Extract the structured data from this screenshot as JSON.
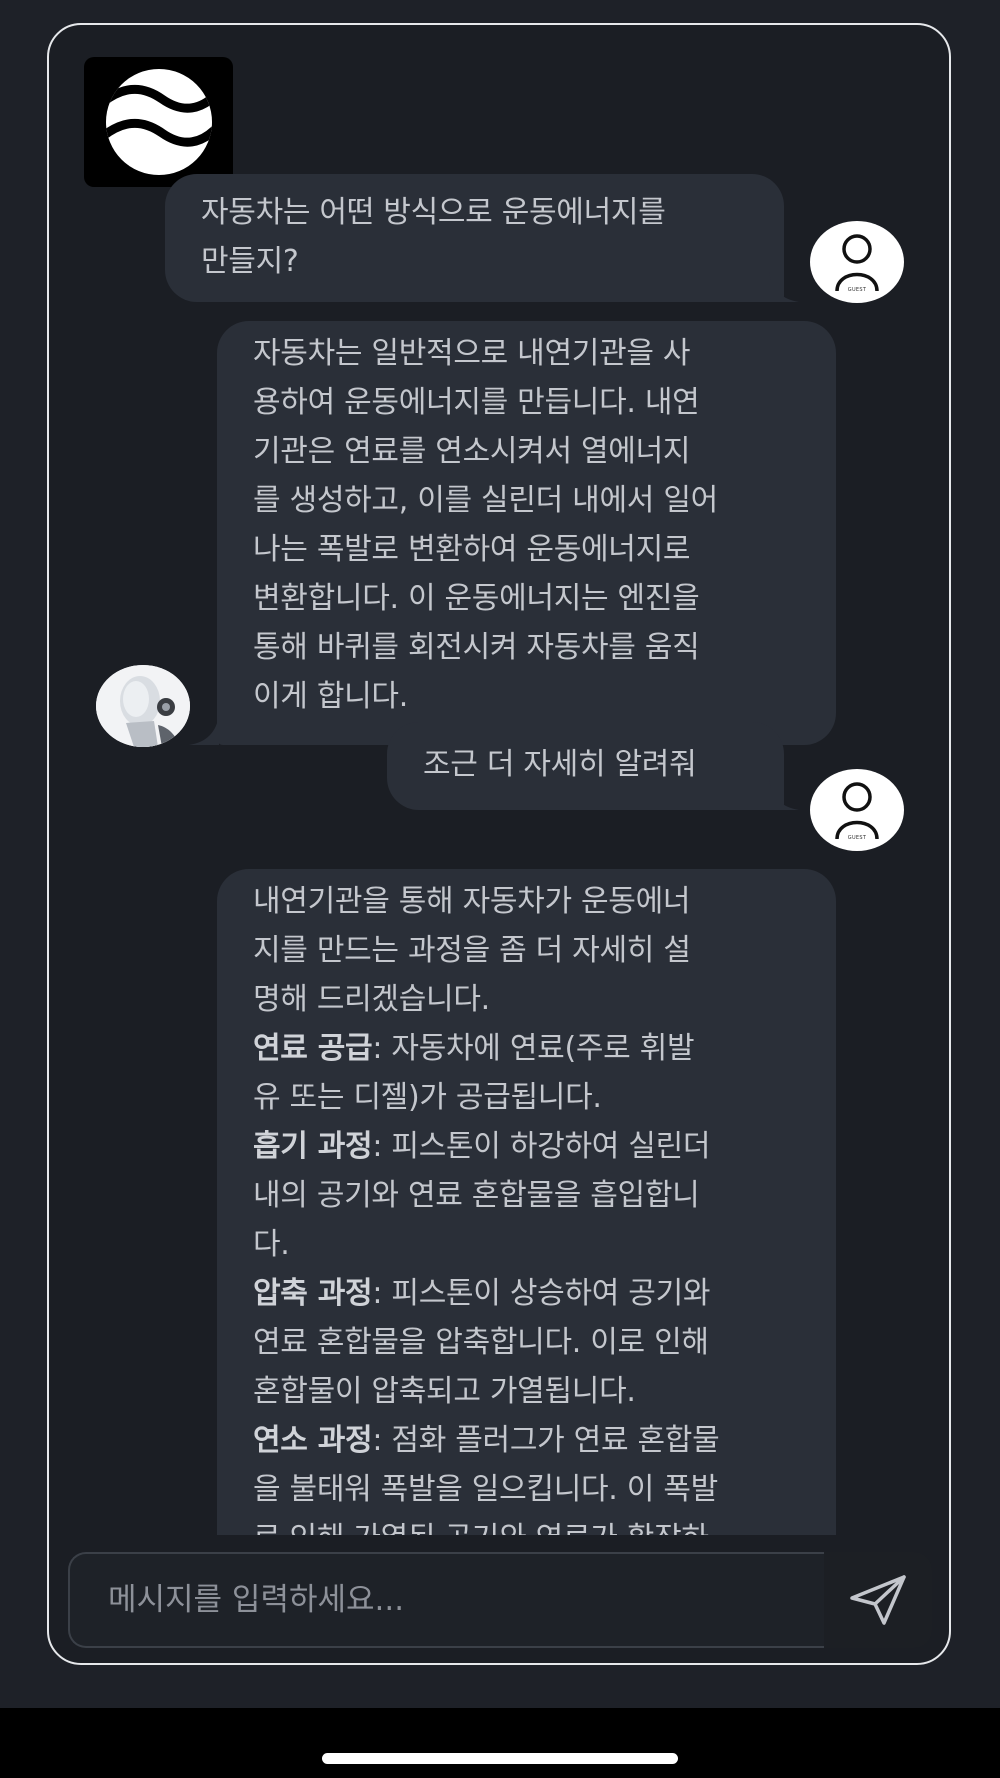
{
  "messages": [
    {
      "role": "user",
      "text": "자동차는 어떤 방식으로 운동에너지를 만들지?"
    },
    {
      "role": "ai",
      "lines": [
        "자동차는 일반적으로 내연기관을 사",
        "용하여 운동에너지를 만듭니다. 내연",
        "기관은 연료를 연소시켜서 열에너지",
        "를 생성하고, 이를 실린더 내에서 일어",
        "나는 폭발로 변환하여 운동에너지로",
        "변환합니다. 이 운동에너지는 엔진을",
        "통해 바퀴를 회전시켜 자동차를 움직",
        "이게 합니다."
      ]
    },
    {
      "role": "user",
      "text": "조근 더 자세히 알려줘"
    },
    {
      "role": "ai",
      "intro": [
        "내연기관을 통해 자동차가 운동에너",
        "지를 만드는 과정을 좀 더 자세히 설",
        "명해 드리겠습니다."
      ],
      "steps": [
        {
          "title": "연료 공급",
          "lines": [
            ": 자동차에 연료(주로 휘발",
            "유 또는 디젤)가 공급됩니다."
          ]
        },
        {
          "title": "흡기 과정",
          "lines": [
            ": 피스톤이 하강하여 실린더",
            "내의 공기와 연료 혼합물을 흡입합니",
            "다."
          ]
        },
        {
          "title": "압축 과정",
          "lines": [
            ": 피스톤이 상승하여 공기와",
            "연료 혼합물을 압축합니다. 이로 인해",
            "혼합물이 압축되고 가열됩니다."
          ]
        },
        {
          "title": "연소 과정",
          "lines": [
            ": 점화 플러그가 연료 혼합물",
            "을 불태워 폭발을 일으킵니다. 이 폭발",
            "로 인해 가열된 공기와 연료가 확장하"
          ]
        }
      ]
    }
  ],
  "avatars": {
    "guest_label": "GUEST"
  },
  "input": {
    "placeholder": "메시지를 입력하세요..."
  },
  "icons": {
    "logo": "waves-logo-icon",
    "send": "send-icon",
    "guest": "guest-avatar-icon",
    "ai": "robot-avatar"
  }
}
